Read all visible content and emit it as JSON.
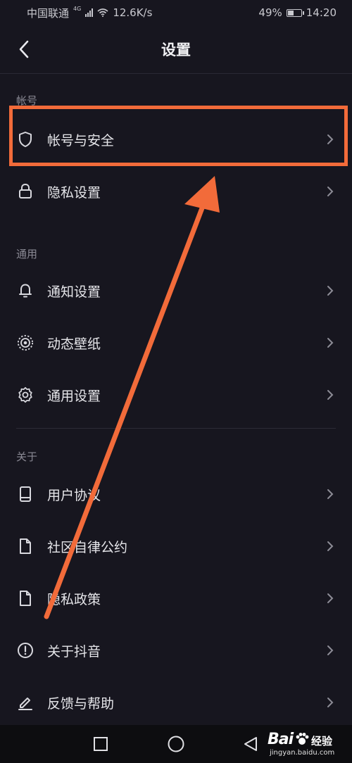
{
  "status_bar": {
    "carrier": "中国联通",
    "network": "4G",
    "speed": "12.6K/s",
    "battery": "49%",
    "battery_level": 0.49,
    "time": "14:20"
  },
  "header": {
    "title": "设置"
  },
  "sections": [
    {
      "title": "帐号",
      "items": [
        {
          "label": "帐号与安全",
          "icon": "shield-icon"
        },
        {
          "label": "隐私设置",
          "icon": "lock-icon"
        }
      ]
    },
    {
      "title": "通用",
      "items": [
        {
          "label": "通知设置",
          "icon": "bell-icon"
        },
        {
          "label": "动态壁纸",
          "icon": "live-wallpaper-icon"
        },
        {
          "label": "通用设置",
          "icon": "gear-icon"
        }
      ]
    },
    {
      "title": "关于",
      "items": [
        {
          "label": "用户协议",
          "icon": "book-icon"
        },
        {
          "label": "社区自律公约",
          "icon": "document-icon"
        },
        {
          "label": "隐私政策",
          "icon": "document-icon"
        },
        {
          "label": "关于抖音",
          "icon": "info-icon"
        },
        {
          "label": "反馈与帮助",
          "icon": "edit-icon"
        }
      ]
    }
  ],
  "annotation": {
    "highlight_color": "#f26b3a"
  },
  "watermark": {
    "brand": "Bai",
    "text": "经验",
    "url": "jingyan.baidu.com"
  },
  "colors": {
    "background": "#17161f",
    "text": "#e6e6ea",
    "secondary_text": "#8a8994",
    "accent": "#f26b3a"
  }
}
